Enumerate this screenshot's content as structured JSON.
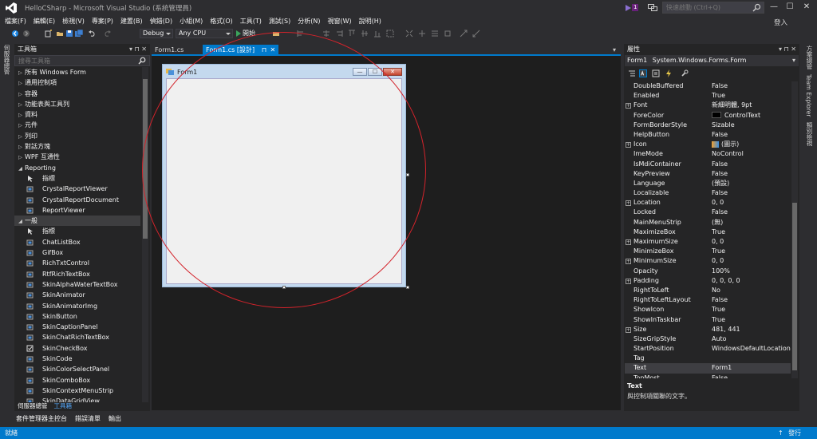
{
  "window": {
    "title": "HelloCSharp - Microsoft Visual Studio (系統管理員)",
    "notification_count": "1",
    "quick_launch_placeholder": "快速啟動 (Ctrl+Q)",
    "min_label": "—",
    "max_label": "☐",
    "close_label": "✕",
    "login": "登入"
  },
  "menu": [
    "檔案(F)",
    "編輯(E)",
    "檢視(V)",
    "專案(P)",
    "建置(B)",
    "偵錯(D)",
    "小組(M)",
    "格式(O)",
    "工具(T)",
    "測試(S)",
    "分析(N)",
    "視窗(W)",
    "說明(H)"
  ],
  "toolbar": {
    "config": "Debug",
    "platform": "Any CPU",
    "start_label": "開始"
  },
  "left_edge": {
    "tab": "伺服器總管"
  },
  "toolbox": {
    "title": "工具箱",
    "pin": "▾ ⊓ ✕",
    "search_placeholder": "搜尋工具箱",
    "rows": [
      {
        "type": "cat",
        "arrow": "▷",
        "label": "所有 Windows Form"
      },
      {
        "type": "cat",
        "arrow": "▷",
        "label": "通用控制項"
      },
      {
        "type": "cat",
        "arrow": "▷",
        "label": "容器"
      },
      {
        "type": "cat",
        "arrow": "▷",
        "label": "功能表與工具列"
      },
      {
        "type": "cat",
        "arrow": "▷",
        "label": "資料"
      },
      {
        "type": "cat",
        "arrow": "▷",
        "label": "元件"
      },
      {
        "type": "cat",
        "arrow": "▷",
        "label": "列印"
      },
      {
        "type": "cat",
        "arrow": "▷",
        "label": "對話方塊"
      },
      {
        "type": "cat",
        "arrow": "▷",
        "label": "WPF 互通性"
      },
      {
        "type": "cat",
        "arrow": "◢",
        "label": "Reporting"
      },
      {
        "type": "item",
        "icon": "pointer",
        "label": "指標"
      },
      {
        "type": "item",
        "icon": "component",
        "label": "CrystalReportViewer"
      },
      {
        "type": "item",
        "icon": "component",
        "label": "CrystalReportDocument"
      },
      {
        "type": "item",
        "icon": "component",
        "label": "ReportViewer"
      },
      {
        "type": "cat",
        "arrow": "◢",
        "label": "一般",
        "selected": true
      },
      {
        "type": "item",
        "icon": "pointer",
        "label": "指標"
      },
      {
        "type": "item",
        "icon": "component",
        "label": "ChatListBox"
      },
      {
        "type": "item",
        "icon": "component",
        "label": "GifBox"
      },
      {
        "type": "item",
        "icon": "component",
        "label": "RichTxtControl"
      },
      {
        "type": "item",
        "icon": "component",
        "label": "RtfRichTextBox"
      },
      {
        "type": "item",
        "icon": "component",
        "label": "SkinAlphaWaterTextBox"
      },
      {
        "type": "item",
        "icon": "component",
        "label": "SkinAnimator"
      },
      {
        "type": "item",
        "icon": "component",
        "label": "SkinAnimatorImg"
      },
      {
        "type": "item",
        "icon": "component",
        "label": "SkinButton"
      },
      {
        "type": "item",
        "icon": "component",
        "label": "SkinCaptionPanel"
      },
      {
        "type": "item",
        "icon": "component",
        "label": "SkinChatRichTextBox"
      },
      {
        "type": "item",
        "icon": "checkbox",
        "label": "SkinCheckBox"
      },
      {
        "type": "item",
        "icon": "component",
        "label": "SkinCode"
      },
      {
        "type": "item",
        "icon": "component",
        "label": "SkinColorSelectPanel"
      },
      {
        "type": "item",
        "icon": "component",
        "label": "SkinComboBox"
      },
      {
        "type": "item",
        "icon": "component",
        "label": "SkinContextMenuStrip"
      },
      {
        "type": "item",
        "icon": "component",
        "label": "SkinDataGridView"
      }
    ],
    "bottom_tabs": [
      "伺服器總管",
      "工具箱"
    ],
    "bottom_tabs2": [
      "套件管理器主控台",
      "錯誤清單",
      "輸出"
    ]
  },
  "documents": {
    "tabs": [
      {
        "label": "Form1.cs",
        "active": false
      },
      {
        "label": "Form1.cs [設計]",
        "active": true
      }
    ],
    "pin_icon": "⊓",
    "close_icon": "✕"
  },
  "form": {
    "title": "Form1",
    "min": "—",
    "max": "☐",
    "close": "✕"
  },
  "properties": {
    "title": "屬性",
    "pin": "▾ ⊓ ✕",
    "object": "Form1",
    "object_type": "System.Windows.Forms.Form",
    "rows": [
      {
        "name": "DoubleBuffered",
        "value": "False"
      },
      {
        "name": "Enabled",
        "value": "True"
      },
      {
        "name": "Font",
        "value": "新細明體, 9pt",
        "expand": true
      },
      {
        "name": "ForeColor",
        "value": "ControlText",
        "swatch": "#000000"
      },
      {
        "name": "FormBorderStyle",
        "value": "Sizable"
      },
      {
        "name": "HelpButton",
        "value": "False"
      },
      {
        "name": "Icon",
        "value": "(圖示)",
        "expand": true,
        "iconsw": true
      },
      {
        "name": "ImeMode",
        "value": "NoControl"
      },
      {
        "name": "IsMdiContainer",
        "value": "False"
      },
      {
        "name": "KeyPreview",
        "value": "False"
      },
      {
        "name": "Language",
        "value": "(預設)"
      },
      {
        "name": "Localizable",
        "value": "False"
      },
      {
        "name": "Location",
        "value": "0, 0",
        "expand": true
      },
      {
        "name": "Locked",
        "value": "False"
      },
      {
        "name": "MainMenuStrip",
        "value": "(無)"
      },
      {
        "name": "MaximizeBox",
        "value": "True"
      },
      {
        "name": "MaximumSize",
        "value": "0, 0",
        "expand": true
      },
      {
        "name": "MinimizeBox",
        "value": "True"
      },
      {
        "name": "MinimumSize",
        "value": "0, 0",
        "expand": true
      },
      {
        "name": "Opacity",
        "value": "100%"
      },
      {
        "name": "Padding",
        "value": "0, 0, 0, 0",
        "expand": true
      },
      {
        "name": "RightToLeft",
        "value": "No"
      },
      {
        "name": "RightToLeftLayout",
        "value": "False"
      },
      {
        "name": "ShowIcon",
        "value": "True"
      },
      {
        "name": "ShowInTaskbar",
        "value": "True"
      },
      {
        "name": "Size",
        "value": "481, 441",
        "expand": true
      },
      {
        "name": "SizeGripStyle",
        "value": "Auto"
      },
      {
        "name": "StartPosition",
        "value": "WindowsDefaultLocation"
      },
      {
        "name": "Tag",
        "value": ""
      },
      {
        "name": "Text",
        "value": "Form1",
        "selected": true
      },
      {
        "name": "TopMost",
        "value": "False"
      }
    ],
    "desc_title": "Text",
    "desc": "與控制項關聯的文字。"
  },
  "right_edge": {
    "tabs": [
      "方案總管",
      "Team Explorer",
      "類別檢視"
    ]
  },
  "status": {
    "left": "就緒",
    "right": "發行",
    "up_icon": "↑"
  },
  "colors": {
    "accent": "#007acc",
    "annotation_circle": "#d3232b"
  }
}
